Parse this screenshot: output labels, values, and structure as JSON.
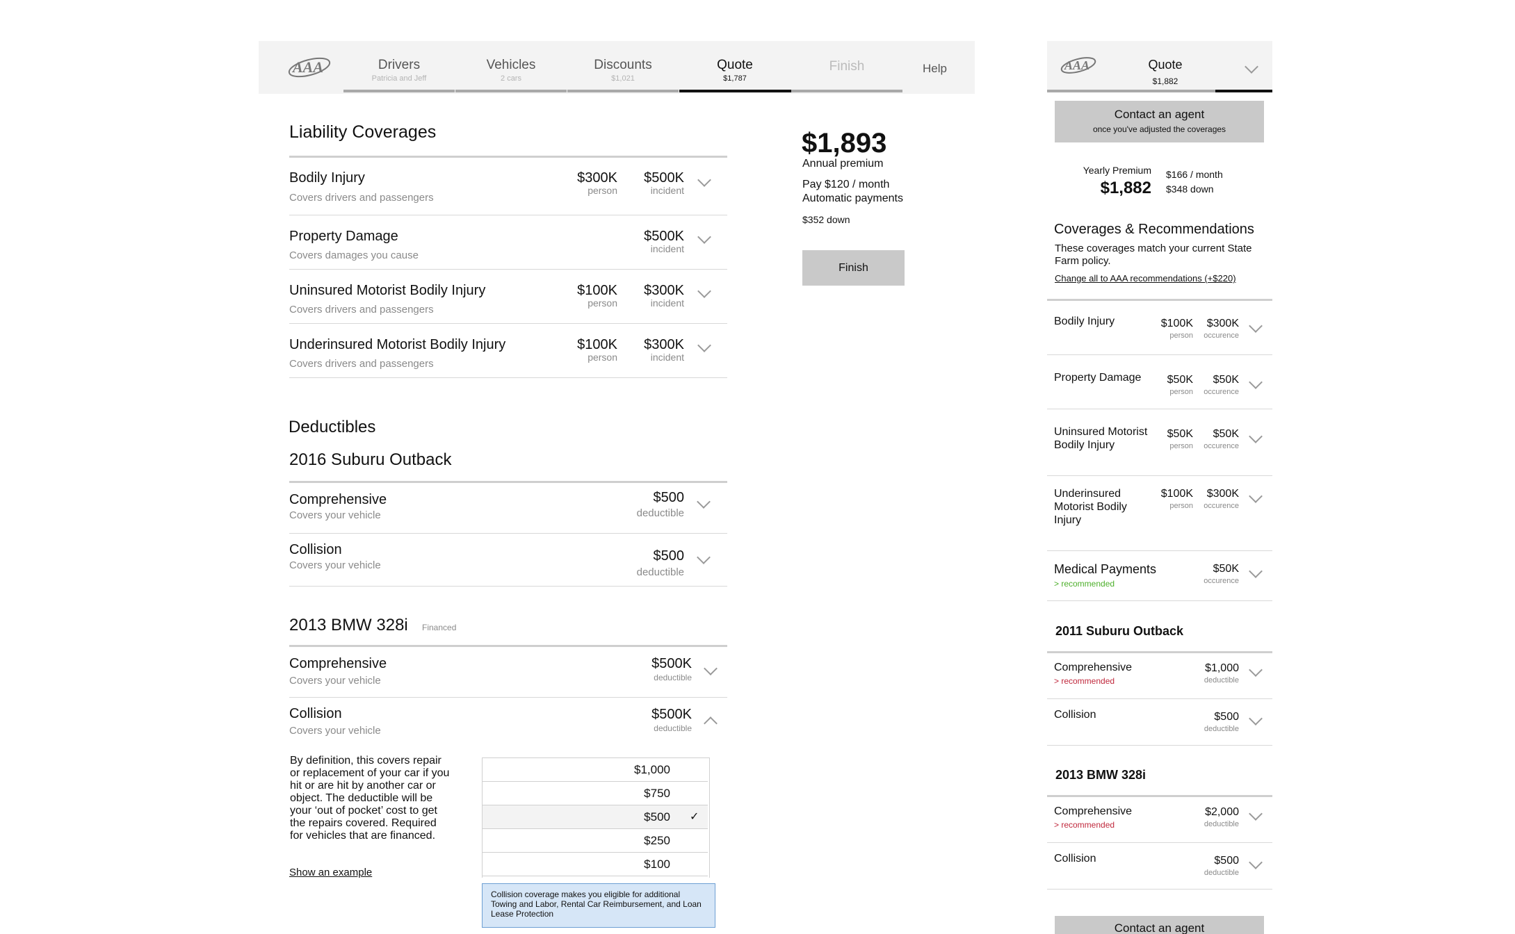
{
  "desktop": {
    "nav": {
      "tabs": [
        {
          "title": "Drivers",
          "sub": "Patricia and Jeff"
        },
        {
          "title": "Vehicles",
          "sub": "2 cars"
        },
        {
          "title": "Discounts",
          "sub": "$1,021"
        },
        {
          "title": "Quote",
          "sub": "$1,787"
        },
        {
          "title": "Finish",
          "sub": ""
        }
      ],
      "help": "Help"
    },
    "liability": {
      "title": "Liability Coverages",
      "rows": [
        {
          "name": "Bodily Injury",
          "desc": "Covers drivers and passengers",
          "v1": "$300K",
          "l1": "person",
          "v2": "$500K",
          "l2": "incident"
        },
        {
          "name": "Property Damage",
          "desc": "Covers damages you cause",
          "v1": "",
          "l1": "",
          "v2": "$500K",
          "l2": "incident"
        },
        {
          "name": "Uninsured Motorist Bodily Injury",
          "desc": "Covers drivers and passengers",
          "v1": "$100K",
          "l1": "person",
          "v2": "$300K",
          "l2": "incident"
        },
        {
          "name": "Underinsured Motorist Bodily Injury",
          "desc": "Covers drivers and passengers",
          "v1": "$100K",
          "l1": "person",
          "v2": "$300K",
          "l2": "incident"
        }
      ]
    },
    "deductibles": {
      "title": "Deductibles",
      "car1": {
        "name": "2016 Suburu Outback",
        "rows": [
          {
            "name": "Comprehensive",
            "desc": "Covers your vehicle",
            "value": "$500",
            "label": "deductible"
          },
          {
            "name": "Collision",
            "desc": "Covers your vehicle",
            "value": "$500",
            "label": "deductible"
          }
        ]
      },
      "car2": {
        "name": "2013 BMW 328i",
        "badge": "Financed",
        "rows": [
          {
            "name": "Comprehensive",
            "desc": "Covers your vehicle",
            "value": "$500K",
            "label": "deductible"
          },
          {
            "name": "Collision",
            "desc": "Covers your vehicle",
            "value": "$500K",
            "label": "deductible"
          }
        ]
      },
      "explain": "By definition, this covers repair or replacement of your car if you hit or are hit by another car or object. The deductible will be your ‘out of pocket’ cost to get the repairs covered. Required for vehicles that are financed.",
      "show_example": "Show an example",
      "options": [
        "$1,000",
        "$750",
        "$500",
        "$250",
        "$100"
      ],
      "selected": "$500",
      "check": "✓",
      "note": "Collision coverage makes you eligible for additional Towing and Labor, Rental Car Reimbursement, and Loan Lease Protection"
    },
    "summary": {
      "price": "$1,893",
      "price_label": "Annual premium",
      "monthly": "Pay $120 / month",
      "auto": "Automatic payments",
      "down": "$352 down",
      "finish": "Finish"
    }
  },
  "mobile": {
    "header": {
      "title": "Quote",
      "sub": "$1,882"
    },
    "contact": {
      "label": "Contact an agent",
      "sub": "once you've adjusted the coverages"
    },
    "premium": {
      "label": "Yearly Premium",
      "value": "$1,882",
      "monthly": "$166 / month",
      "down": "$348 down"
    },
    "coverages": {
      "title": "Coverages & Recommendations",
      "desc": "These coverages match your current State Farm policy.",
      "link": "Change all to AAA recommendations (+$220)",
      "rows": [
        {
          "name": "Bodily Injury",
          "v1": "$100K",
          "l1": "person",
          "v2": "$300K",
          "l2": "occurence"
        },
        {
          "name": "Property Damage",
          "v1": "$50K",
          "l1": "person",
          "v2": "$50K",
          "l2": "occurence"
        },
        {
          "name": "Uninsured Motorist Bodily Injury",
          "v1": "$50K",
          "l1": "person",
          "v2": "$50K",
          "l2": "occurence"
        },
        {
          "name": "Underinsured Motorist Bodily Injury",
          "v1": "$100K",
          "l1": "person",
          "v2": "$300K",
          "l2": "occurence"
        }
      ],
      "medical": {
        "name": "Medical Payments",
        "rec": "> recommended",
        "value": "$50K",
        "label": "occurence"
      }
    },
    "car1": {
      "name": "2011 Suburu Outback",
      "rows": [
        {
          "name": "Comprehensive",
          "rec": "> recommended",
          "value": "$1,000",
          "label": "deductible"
        },
        {
          "name": "Collision",
          "rec": "",
          "value": "$500",
          "label": "deductible"
        }
      ]
    },
    "car2": {
      "name": "2013 BMW 328i",
      "rows": [
        {
          "name": "Comprehensive",
          "rec": "> recommended",
          "value": "$2,000",
          "label": "deductible"
        },
        {
          "name": "Collision",
          "rec": "",
          "value": "$500",
          "label": "deductible"
        }
      ]
    },
    "contact_bottom": "Contact an agent"
  },
  "colors": {
    "green": "#4caf2a",
    "red": "#c0283c",
    "note_bg": "#d6e6f7",
    "note_border": "#6d9fd3"
  }
}
